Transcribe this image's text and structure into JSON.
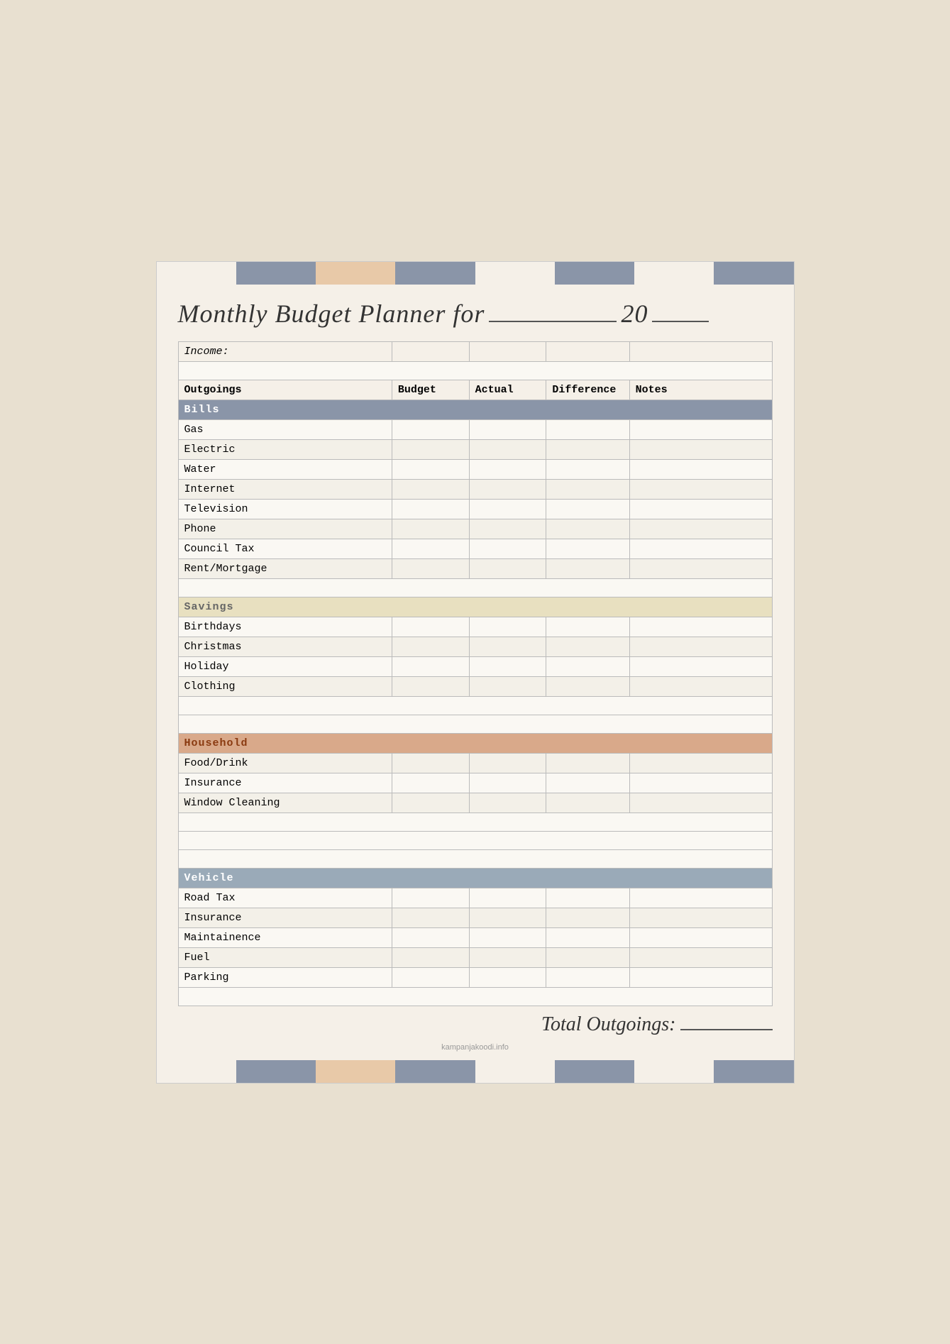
{
  "page": {
    "title": "Monthly Budget Planner for",
    "year_prefix": "20",
    "total_label": "Total Outgoings:",
    "watermark": "kampanjakoodi.info"
  },
  "topbar": [
    {
      "color": "#f5f0e8"
    },
    {
      "color": "#8a95a8"
    },
    {
      "color": "#e8c9a8"
    },
    {
      "color": "#8a95a8"
    },
    {
      "color": "#f5f0e8"
    },
    {
      "color": "#8a95a8"
    },
    {
      "color": "#f5f0e8"
    },
    {
      "color": "#8a95a8"
    }
  ],
  "bottombar": [
    {
      "color": "#f5f0e8"
    },
    {
      "color": "#8a95a8"
    },
    {
      "color": "#e8c9a8"
    },
    {
      "color": "#8a95a8"
    },
    {
      "color": "#f5f0e8"
    },
    {
      "color": "#8a95a8"
    },
    {
      "color": "#f5f0e8"
    },
    {
      "color": "#8a95a8"
    }
  ],
  "headers": {
    "outgoings": "Outgoings",
    "budget": "Budget",
    "actual": "Actual",
    "difference": "Difference",
    "notes": "Notes",
    "income": "Income:"
  },
  "sections": {
    "bills": {
      "label": "Bills",
      "items": [
        "Gas",
        "Electric",
        "Water",
        "Internet",
        "Television",
        "Phone",
        "Council Tax",
        "Rent/Mortgage"
      ]
    },
    "savings": {
      "label": "Savings",
      "items": [
        "Birthdays",
        "Christmas",
        "Holiday",
        "Clothing"
      ]
    },
    "household": {
      "label": "Household",
      "items": [
        "Food/Drink",
        "Insurance",
        "Window Cleaning"
      ]
    },
    "vehicle": {
      "label": "Vehicle",
      "items": [
        "Road Tax",
        "Insurance",
        "Maintainence",
        "Fuel",
        "Parking"
      ]
    }
  }
}
